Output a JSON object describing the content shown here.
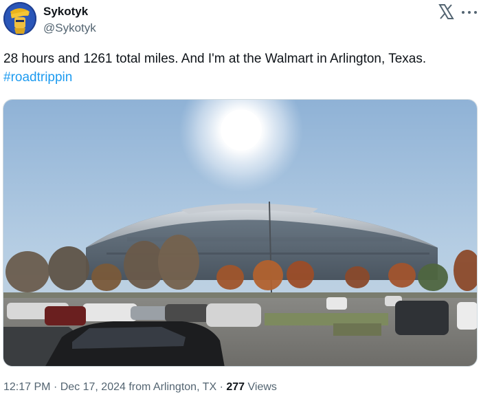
{
  "author": {
    "display_name": "Sykotyk",
    "handle": "@Sykotyk",
    "avatar_icon": "avatar-icon"
  },
  "header": {
    "logo_icon": "x-logo-icon",
    "more_icon": "more-options-icon"
  },
  "tweet": {
    "text": "28 hours and 1261 total miles. And I'm at the Walmart in Arlington, Texas.",
    "hashtag": "#roadtrippin"
  },
  "media": {
    "type": "photo"
  },
  "footer": {
    "time": "12:17 PM",
    "date": "Dec 17, 2024",
    "location_prefix": "from",
    "location": "Arlington, TX",
    "separator": "·",
    "views_count": "277",
    "views_label": "Views"
  },
  "colors": {
    "link": "#1d9bf0",
    "text": "#0f1419",
    "secondary": "#536471"
  }
}
